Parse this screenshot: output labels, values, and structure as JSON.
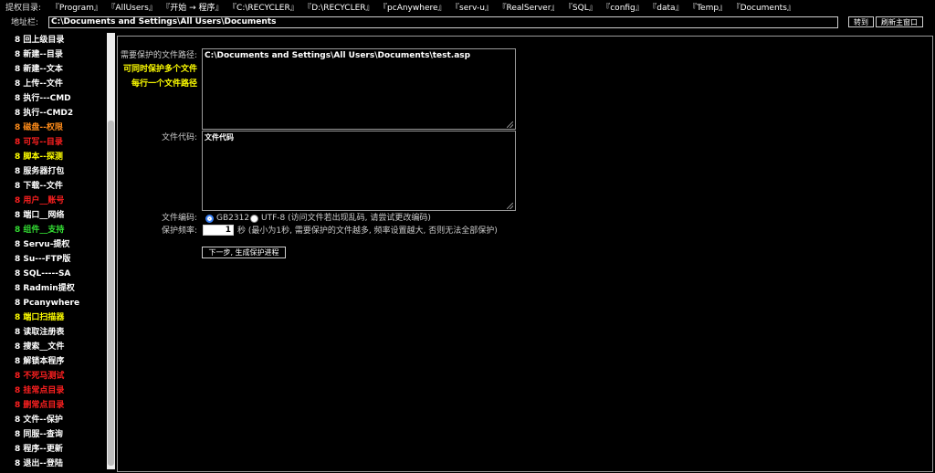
{
  "quick_nav": {
    "label": "提权目录:",
    "links": [
      "『Program』",
      "『AllUsers』",
      "『开始 → 程序』",
      "『C:\\RECYCLER』",
      "『D:\\RECYCLER』",
      "『pcAnywhere』",
      "『serv-u』",
      "『RealServer』",
      "『SQL』",
      "『config』",
      "『data』",
      "『Temp』",
      "『Documents』"
    ]
  },
  "address": {
    "label": "地址栏:",
    "value": "C:\\Documents and Settings\\All Users\\Documents",
    "go_label": "转到",
    "refresh_label": "刷新主窗口"
  },
  "sidebar": {
    "items": [
      {
        "label": "8 回上级目录",
        "color": "#ffffff"
      },
      {
        "label": "8 新建--目录",
        "color": "#ffffff"
      },
      {
        "label": "8 新建--文本",
        "color": "#ffffff"
      },
      {
        "label": "8 上传--文件",
        "color": "#ffffff"
      },
      {
        "label": "8 执行---CMD",
        "color": "#ffffff"
      },
      {
        "label": "8 执行--CMD2",
        "color": "#ffffff"
      },
      {
        "label": "8 磁盘--权限",
        "color": "#ff8c1a"
      },
      {
        "label": "8 可写--目录",
        "color": "#ff2020"
      },
      {
        "label": "8 脚本--探测",
        "color": "#ffff00"
      },
      {
        "label": "8 服务器打包",
        "color": "#ffffff"
      },
      {
        "label": "8 下载--文件",
        "color": "#ffffff"
      },
      {
        "label": "8 用户__账号",
        "color": "#ff2020"
      },
      {
        "label": "8 端口__网络",
        "color": "#ffffff"
      },
      {
        "label": "8 组件__支持",
        "color": "#33dd33"
      },
      {
        "label": "8 Servu-提权",
        "color": "#ffffff"
      },
      {
        "label": "8 Su---FTP版",
        "color": "#ffffff"
      },
      {
        "label": "8 SQL-----SA",
        "color": "#ffffff"
      },
      {
        "label": "8 Radmin提权",
        "color": "#ffffff"
      },
      {
        "label": "8 Pcanywhere",
        "color": "#ffffff"
      },
      {
        "label": "8 端口扫描器",
        "color": "#ffff00"
      },
      {
        "label": "8 读取注册表",
        "color": "#ffffff"
      },
      {
        "label": "8 搜索__文件",
        "color": "#ffffff"
      },
      {
        "label": "8 解锁本程序",
        "color": "#ffffff"
      },
      {
        "label": "8 不死马测试",
        "color": "#ff2020"
      },
      {
        "label": "8 挂常点目录",
        "color": "#ff2020"
      },
      {
        "label": "8 删常点目录",
        "color": "#ff2020"
      },
      {
        "label": "8 文件--保护",
        "color": "#ffffff"
      },
      {
        "label": "8 同服--查询",
        "color": "#ffffff"
      },
      {
        "label": "8 程序--更新",
        "color": "#ffffff"
      },
      {
        "label": "8 退出--登陆",
        "color": "#ffffff"
      }
    ]
  },
  "form": {
    "path_label": "需要保护的文件路径:",
    "hint_line1": "可同时保护多个文件",
    "hint_line2": "每行一个文件路径",
    "path_value": "C:\\Documents and Settings\\All Users\\Documents\\test.asp",
    "code_label": "文件代码:",
    "code_value": "文件代码",
    "encoding_label": "文件编码:",
    "encoding_option1": "GB2312",
    "encoding_option2": "UTF-8 (访问文件若出现乱码, 请尝试更改编码)",
    "frequency_label": "保护频率:",
    "frequency_value": "1",
    "frequency_note": "秒 (最小为1秒, 需要保护的文件越多, 频率设置越大, 否则无法全部保护)",
    "submit_label": "下一步, 生成保护进程"
  }
}
